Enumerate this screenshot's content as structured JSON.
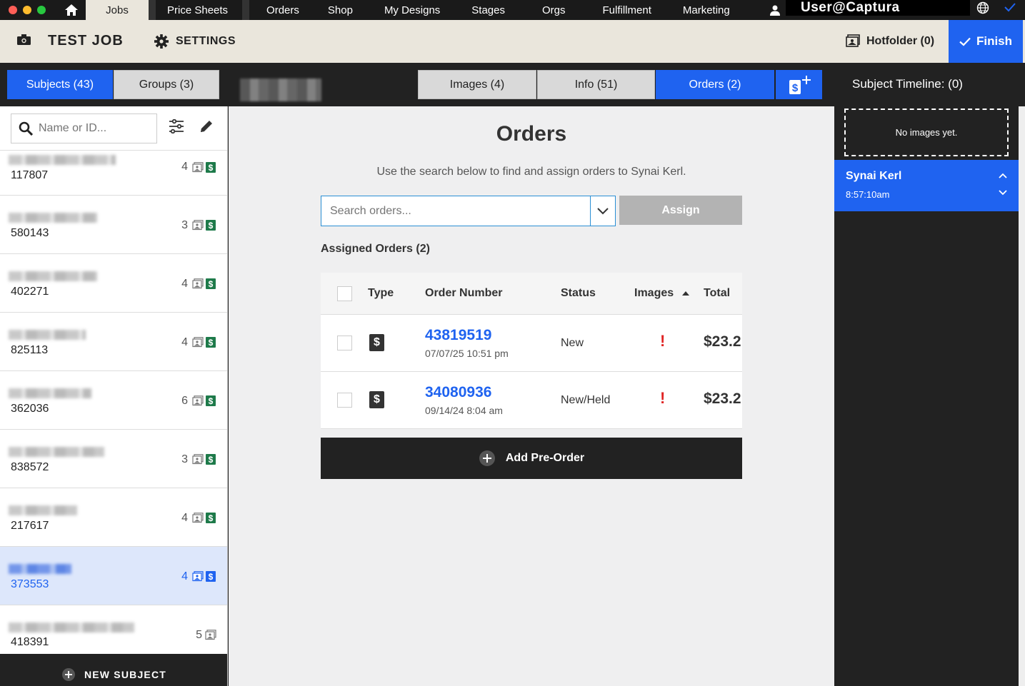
{
  "colors": {
    "accent": "#1f63f0",
    "money_green": "#1e7a4a",
    "alert_red": "#e02424",
    "header_bg": "#eae6dc"
  },
  "nav": {
    "tabs": [
      "Jobs",
      "Price Sheets",
      "Orders",
      "Shop",
      "My Designs",
      "Stages",
      "Orgs",
      "Fulfillment",
      "Marketing"
    ],
    "user": "User@Captura"
  },
  "job": {
    "title": "TEST JOB",
    "settings_label": "SETTINGS",
    "hotfolder_label": "Hotfolder (0)",
    "finish_label": "Finish"
  },
  "left_tabs": {
    "subjects": "Subjects (43)",
    "groups": "Groups (3)"
  },
  "main_tabs": {
    "images": "Images (4)",
    "info": "Info (51)",
    "orders": "Orders (2)"
  },
  "subjects": {
    "search_placeholder": "Name or ID...",
    "items": [
      {
        "id": "117807",
        "count": "4"
      },
      {
        "id": "580143",
        "count": "3"
      },
      {
        "id": "402271",
        "count": "4"
      },
      {
        "id": "825113",
        "count": "4"
      },
      {
        "id": "362036",
        "count": "6"
      },
      {
        "id": "838572",
        "count": "3"
      },
      {
        "id": "217617",
        "count": "4"
      },
      {
        "id": "373553",
        "count": "4"
      },
      {
        "id": "418391",
        "count": "5"
      }
    ],
    "new_subject_label": "NEW SUBJECT"
  },
  "orders": {
    "title": "Orders",
    "subtitle": "Use the search below to find and assign orders to Synai Kerl.",
    "search_placeholder": "Search orders...",
    "assign_label": "Assign",
    "assigned_label": "Assigned Orders (2)",
    "columns": {
      "type": "Type",
      "number": "Order Number",
      "status": "Status",
      "images": "Images",
      "total": "Total"
    },
    "rows": [
      {
        "number": "43819519",
        "date": "07/07/25 10:51 pm",
        "status": "New",
        "images": "!",
        "total": "$23.2"
      },
      {
        "number": "34080936",
        "date": "09/14/24 8:04 am",
        "status": "New/Held",
        "images": "!",
        "total": "$23.2"
      }
    ],
    "preorder_label": "Add Pre-Order"
  },
  "timeline": {
    "title": "Subject Timeline: (0)",
    "empty_text": "No images yet.",
    "name": "Synai Kerl",
    "time": "8:57:10am"
  }
}
